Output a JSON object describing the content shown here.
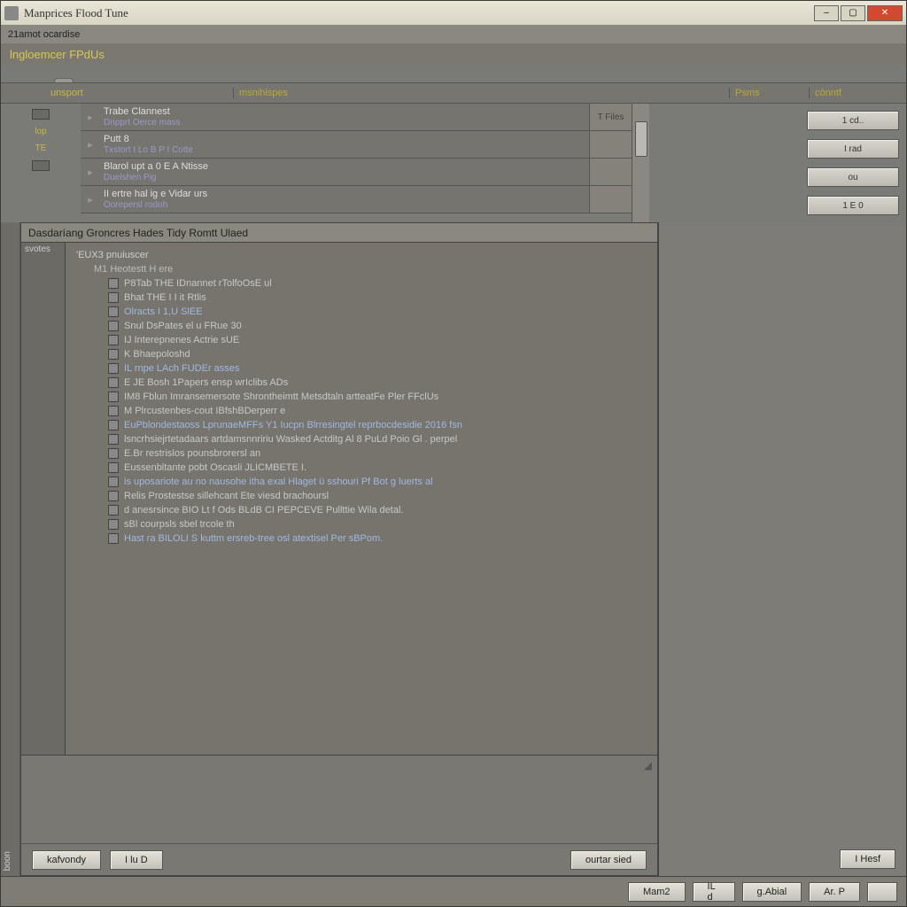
{
  "window": {
    "title": "Manprices Flood Tune",
    "menu": "21amot ocardise"
  },
  "header": {
    "project": "lngloemcer FPdUs"
  },
  "tabs": {
    "t1": ""
  },
  "cols": {
    "c1": "unsport",
    "c2": "msnihispes",
    "c3": "Psms",
    "c4": "cónntf"
  },
  "left_labels": {
    "l1": "lop",
    "l2": "TE"
  },
  "rows": [
    {
      "line1": "Trabe  Clannest",
      "line2": "Dripprt Oerce mass",
      "tag": "T Files"
    },
    {
      "line1": "Putt 8",
      "line2": "Txstort I Lo B P I Cotte",
      "tag": ""
    },
    {
      "line1": "Blarol upt a 0 E A Ntisse",
      "line2": "Duelshen Pig",
      "tag": ""
    },
    {
      "line1": "II ertre hal ig e Vidar urs",
      "line2": "Oorepersl  rodoh",
      "tag": ""
    }
  ],
  "rbtns": {
    "b1": "1 cd..",
    "b2": "I rad",
    "b3": "ou",
    "b4": "1 E 0"
  },
  "inner": {
    "title": "Dasdaríang Groncres Hades Tidy Romtt Ulaed",
    "gutter": "svotes",
    "root": "'EUX3 pnuiuscer",
    "sub": "M1 Heotestt H ere",
    "items": [
      "P8Tab THE  IDnannet rTolfoOsE ul",
      "Bhat THE  I  I it  Rtlis",
      "Olracts I 1,U  SlEE",
      "Snul DsPates el  u  FRue 30",
      "IJ Interepnenes  Actrie sUE",
      "K Bhaepoloshd",
      "IL rnpe LAch FUDEr asses",
      "E JE Bosh 1Papers ensp wrIclibs ADs",
      "IM8 Fblun Imransemersote Shrontheimtt Metsdtaln artteatFe Pler FFclUs",
      "M Plrcustenbes-cout  IBfshBDerperr e",
      "EuPblondestaoss LprunaeMFFs Y1 Iucpn  Blrresingtel reprbocdesidie 2016 fsn",
      "lsncrhsiejrtetadaars artdamsnnririu  Wasked Actditg Al 8 PuLd Poio Gl . perpel",
      "E.Br restrislos pounsbrorersl an ",
      "Eussenbltante pobt  Oscasli JLICMBETE  I.",
      "is uposariote au no nausohe itha exal Hlaget ü sshouri Pf Bot g luerts al",
      "Relis Prostestse  sillehcant Ete viesd brachoursl",
      "d anesrsince BIO Lt  f Ods BLdB CI PEPCEVE Pullttie Wila detal.",
      "sBl courpsls sbel trcole th",
      "Hast ra BILOLI S kuttm ersreb-tree osl atextisel Per sBPom."
    ]
  },
  "side_label": "boon",
  "dlgbtns": {
    "b1": "kafvondy",
    "b2": "I lu D",
    "b3": "ourtar sied",
    "b4": "I Hesf"
  },
  "footer": {
    "b1": "Mam2",
    "b2": "IL d",
    "b3": "g.Abial",
    "b4": "Ar. P"
  }
}
